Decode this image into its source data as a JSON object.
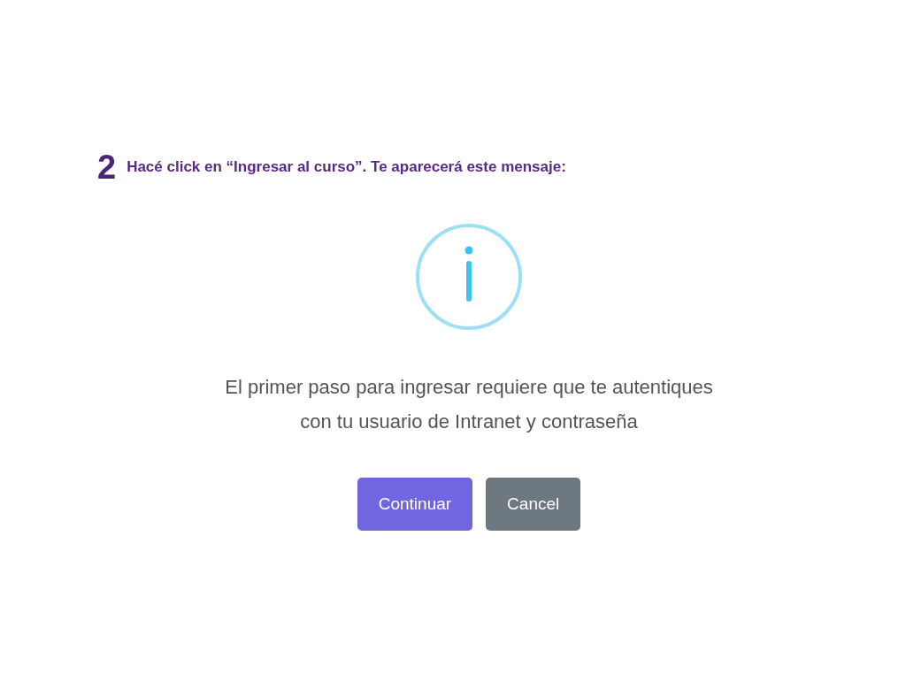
{
  "step": {
    "number": "2",
    "instruction": "Hacé click en “Ingresar al curso”. Te aparecerá este mensaje:"
  },
  "dialog": {
    "message": "El primer paso para ingresar requiere que te autentiques con tu usuario de Intranet y contraseña",
    "buttons": [
      {
        "label": "Continuar",
        "kind": "confirm"
      },
      {
        "label": "Cancel",
        "kind": "cancel"
      }
    ]
  }
}
